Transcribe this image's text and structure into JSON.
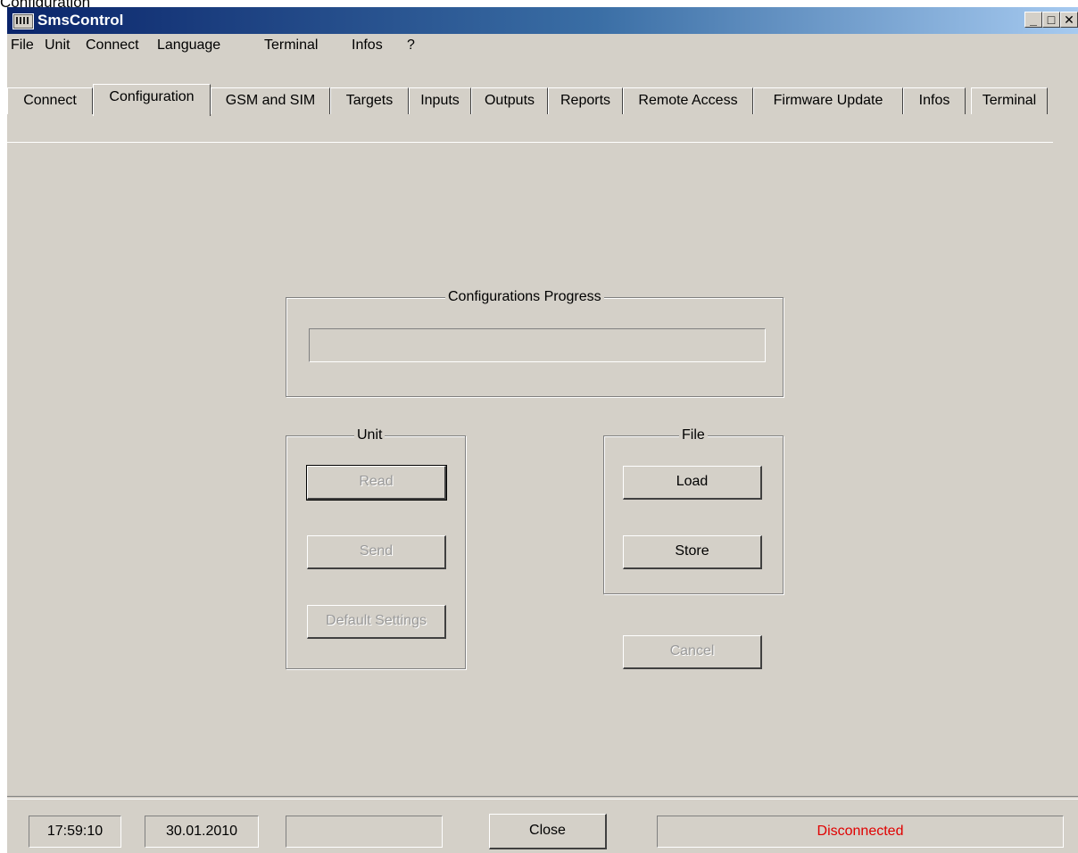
{
  "caption": "Configuration",
  "window": {
    "title": "SmsControl",
    "controls": {
      "minimize": "_",
      "maximize": "□",
      "close": "✕"
    }
  },
  "menu": [
    "File",
    "Unit",
    "Connect",
    "Language",
    "Terminal",
    "Infos",
    "?"
  ],
  "tabs": [
    "Connect",
    "Configuration",
    "GSM and SIM",
    "Targets",
    "Inputs",
    "Outputs",
    "Reports",
    "Remote Access",
    "Firmware Update",
    "Infos",
    "Terminal"
  ],
  "active_tab": "Configuration",
  "progress_group": {
    "label": "Configurations Progress",
    "value": 0
  },
  "unit_group": {
    "label": "Unit",
    "read": "Read",
    "send": "Send",
    "default": "Default Settings"
  },
  "file_group": {
    "label": "File",
    "load": "Load",
    "store": "Store"
  },
  "cancel_label": "Cancel",
  "status": {
    "time": "17:59:10",
    "date": "30.01.2010",
    "info": "",
    "close_label": "Close",
    "connection": "Disconnected",
    "connection_color": "#e00000"
  }
}
